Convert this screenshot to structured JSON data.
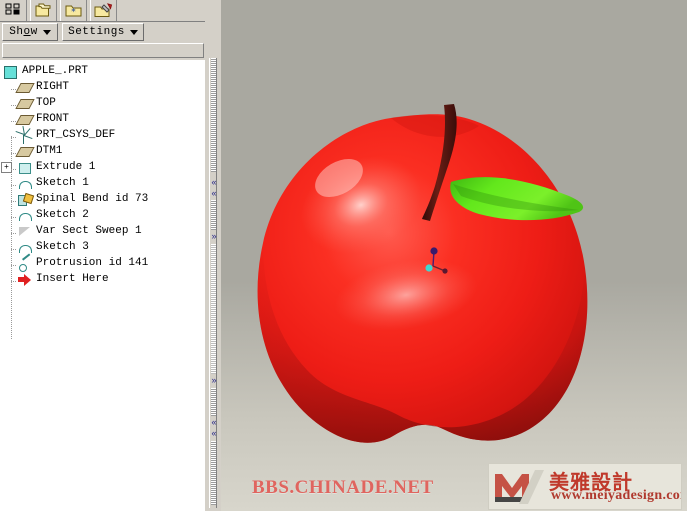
{
  "window": {
    "title": "APPLE_.PRT",
    "background_color": "#a9a8a0"
  },
  "toolbar": {
    "buttons": [
      {
        "name": "select-items-icon",
        "label": "Select Items"
      },
      {
        "name": "folder-copy-icon",
        "label": "Copy Folder"
      },
      {
        "name": "folder-new-icon",
        "label": "New Folder"
      },
      {
        "name": "folder-tools-icon",
        "label": "Folder Tools"
      }
    ]
  },
  "menubar": {
    "show_label": "Show",
    "settings_label": "Settings",
    "caret": "▼"
  },
  "tree": {
    "items": [
      {
        "label": "APPLE_.PRT",
        "icon": "part-icon",
        "level": 0,
        "expander": ""
      },
      {
        "label": "RIGHT",
        "icon": "datum-plane-icon",
        "level": 1,
        "expander": ""
      },
      {
        "label": "TOP",
        "icon": "datum-plane-icon",
        "level": 1,
        "expander": ""
      },
      {
        "label": "FRONT",
        "icon": "datum-plane-icon",
        "level": 1,
        "expander": ""
      },
      {
        "label": "PRT_CSYS_DEF",
        "icon": "coordinate-system-icon",
        "level": 1,
        "expander": ""
      },
      {
        "label": "DTM1",
        "icon": "datum-plane-icon",
        "level": 1,
        "expander": ""
      },
      {
        "label": "Extrude 1",
        "icon": "extrude-icon",
        "level": 1,
        "expander": "+"
      },
      {
        "label": "Sketch 1",
        "icon": "sketch-icon",
        "level": 1,
        "expander": ""
      },
      {
        "label": "Spinal Bend id 73",
        "icon": "spinal-bend-icon",
        "level": 1,
        "expander": ""
      },
      {
        "label": "Sketch 2",
        "icon": "sketch-icon",
        "level": 1,
        "expander": ""
      },
      {
        "label": "Var Sect Sweep 1",
        "icon": "variable-section-sweep-icon",
        "level": 1,
        "expander": ""
      },
      {
        "label": "Sketch 3",
        "icon": "sketch-icon",
        "level": 1,
        "expander": ""
      },
      {
        "label": "Protrusion id 141",
        "icon": "protrusion-icon",
        "level": 1,
        "expander": ""
      },
      {
        "label": "Insert Here",
        "icon": "insert-here-arrow-icon",
        "level": 1,
        "expander": ""
      }
    ]
  },
  "viewport": {
    "model_name": "apple",
    "colors": {
      "body_red": "#f41f1c",
      "body_shadow": "#9c1410",
      "highlight": "#ffb0ac",
      "stem_brown": "#4a1410",
      "leaf_green": "#5ce01a",
      "csys_marker": "#3b1a6b",
      "csys_origin": "#3fd8d0"
    }
  },
  "watermark": {
    "text": "BBS.CHINADE.NET",
    "color": "#e0655f"
  },
  "logo": {
    "mark": "M",
    "chinese": "美雅設計",
    "url": "www.meiyadesign.com",
    "color": "#c0392b"
  },
  "splitter": {
    "chevron_left": "«",
    "chevron_right": "»"
  }
}
